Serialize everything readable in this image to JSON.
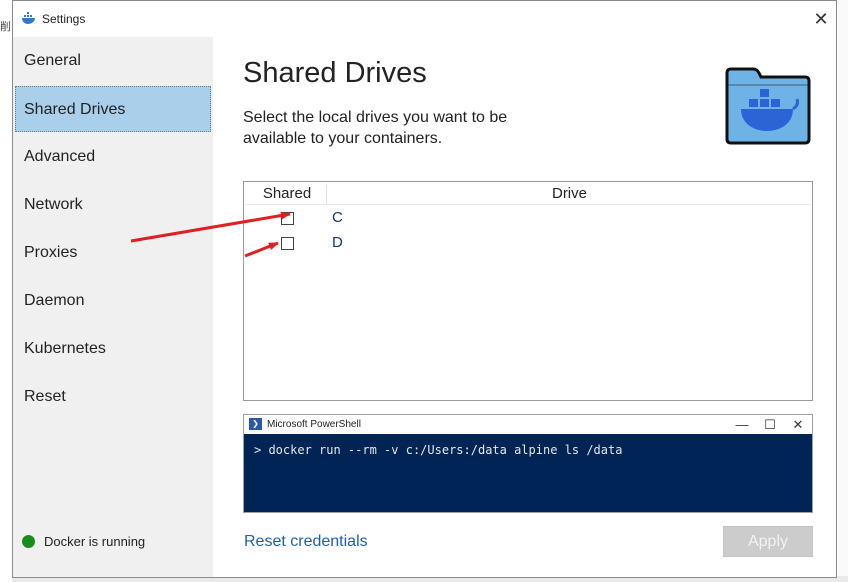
{
  "window": {
    "title": "Settings",
    "close_label": "✕"
  },
  "background": {
    "edge_char": "削"
  },
  "sidebar": {
    "items": [
      {
        "label": "General",
        "active": false
      },
      {
        "label": "Shared Drives",
        "active": true
      },
      {
        "label": "Advanced",
        "active": false
      },
      {
        "label": "Network",
        "active": false
      },
      {
        "label": "Proxies",
        "active": false
      },
      {
        "label": "Daemon",
        "active": false
      },
      {
        "label": "Kubernetes",
        "active": false
      },
      {
        "label": "Reset",
        "active": false
      }
    ],
    "status": {
      "text": "Docker is running",
      "color": "#1a8c1a"
    }
  },
  "main": {
    "title": "Shared Drives",
    "description": "Select the local drives you want to be available to your containers.",
    "table": {
      "col_shared": "Shared",
      "col_drive": "Drive",
      "rows": [
        {
          "drive": "C",
          "checked": false
        },
        {
          "drive": "D",
          "checked": false
        }
      ]
    },
    "powershell": {
      "title": "Microsoft PowerShell",
      "minimize": "—",
      "maximize": "☐",
      "close": "✕",
      "command": "> docker run --rm -v c:/Users:/data alpine ls /data",
      "background_color": "#012456"
    },
    "reset_credentials": "Reset credentials",
    "apply": "Apply"
  },
  "annotations": {
    "arrow_color": "#e02020"
  },
  "colors": {
    "active_nav": "#a9cfea",
    "link": "#1f5fad",
    "folder_blue": "#6fb2e6"
  }
}
